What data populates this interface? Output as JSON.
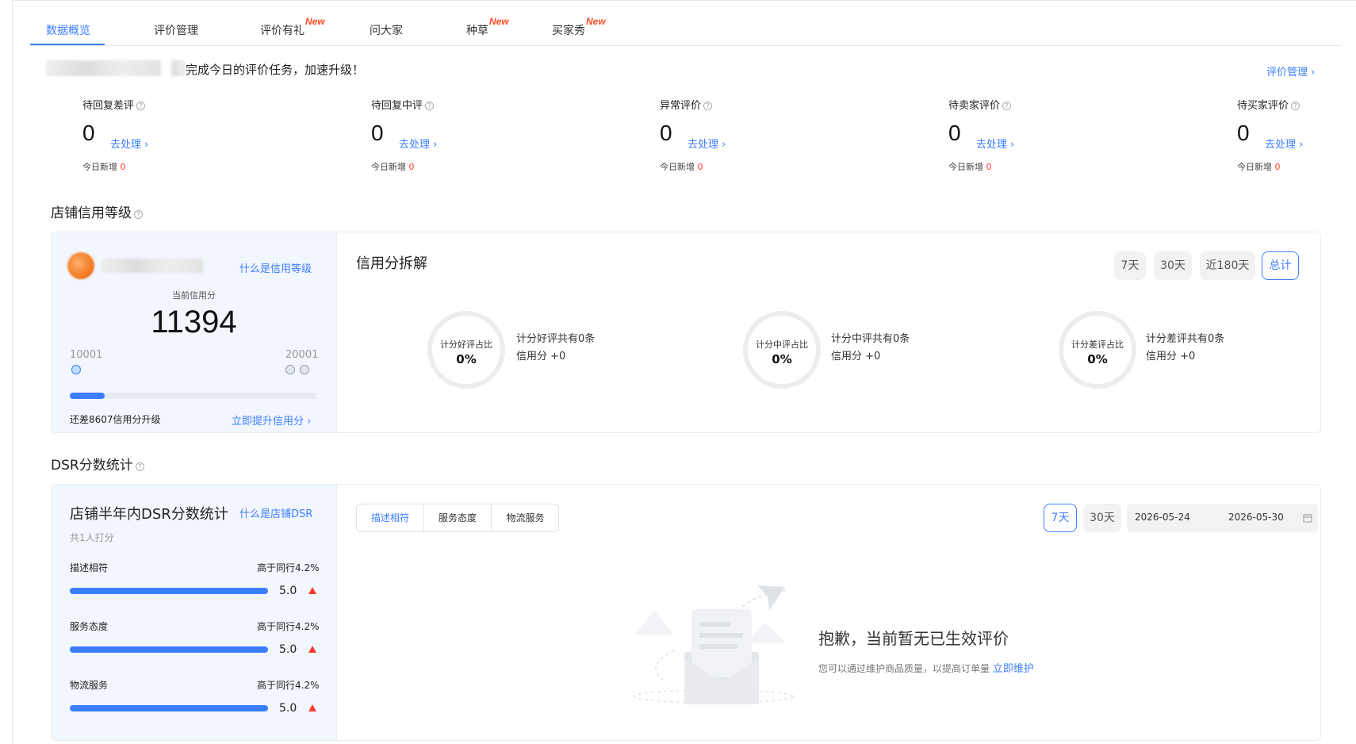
{
  "tabs": [
    {
      "label": "数据概览",
      "active": true
    },
    {
      "label": "评价管理"
    },
    {
      "label": "评价有礼",
      "badge": "New"
    },
    {
      "label": "问大家"
    },
    {
      "label": "种草",
      "badge": "New"
    },
    {
      "label": "买家秀",
      "badge": "New"
    }
  ],
  "notice": {
    "text": "完成今日的评价任务，加速升级！",
    "link": "评价管理 ›"
  },
  "stats": [
    {
      "title": "待回复差评",
      "value": "0",
      "link": "去处理 ›",
      "sub_label": "今日新增",
      "sub_value": "0"
    },
    {
      "title": "待回复中评",
      "value": "0",
      "link": "去处理 ›",
      "sub_label": "今日新增",
      "sub_value": "0"
    },
    {
      "title": "异常评价",
      "value": "0",
      "link": "去处理 ›",
      "sub_label": "今日新增",
      "sub_value": "0"
    },
    {
      "title": "待卖家评价",
      "value": "0",
      "link": "去处理 ›",
      "sub_label": "今日新增",
      "sub_value": "0"
    },
    {
      "title": "待买家评价",
      "value": "0",
      "link": "去处理 ›",
      "sub_label": "今日新增",
      "sub_value": "0"
    }
  ],
  "credit": {
    "section_title": "店铺信用等级",
    "what_link": "什么是信用等级",
    "current_label": "当前信用分",
    "score": "11394",
    "min": "10001",
    "max": "20001",
    "progress": 0.14,
    "remaining_text": "还差8607信用分升级",
    "improve_link": "立即提升信用分 ›"
  },
  "breakdown": {
    "title": "信用分拆解",
    "periods": [
      {
        "label": "7天"
      },
      {
        "label": "30天"
      },
      {
        "label": "近180天"
      },
      {
        "label": "总计",
        "active": true
      }
    ],
    "items": [
      {
        "label": "计分好评占比",
        "value": "0%",
        "line1": "计分好评共有0条",
        "line2": "信用分 +0"
      },
      {
        "label": "计分中评占比",
        "value": "0%",
        "line1": "计分中评共有0条",
        "line2": "信用分 +0"
      },
      {
        "label": "计分差评占比",
        "value": "0%",
        "line1": "计分差评共有0条",
        "line2": "信用分 +0"
      }
    ]
  },
  "dsr": {
    "section_title": "DSR分数统计",
    "card_title": "店铺半年内DSR分数统计",
    "what_link": "什么是店铺DSR",
    "count_text": "共1人打分",
    "rows": [
      {
        "label": "描述相符",
        "compare": "高于同行4.2%",
        "score": "5.0",
        "fraction": 1.0
      },
      {
        "label": "服务态度",
        "compare": "高于同行4.2%",
        "score": "5.0",
        "fraction": 1.0
      },
      {
        "label": "物流服务",
        "compare": "高于同行4.2%",
        "score": "5.0",
        "fraction": 1.0
      }
    ],
    "segments": [
      {
        "label": "描述相符",
        "active": true
      },
      {
        "label": "服务态度"
      },
      {
        "label": "物流服务"
      }
    ],
    "periods": [
      {
        "label": "7天",
        "active": true
      },
      {
        "label": "30天"
      }
    ],
    "date_start": "2026-05-24",
    "date_end": "2026-05-30",
    "empty_title": "抱歉，当前暂无已生效评价",
    "empty_sub": "您可以通过维护商品质量，以提高订单量",
    "empty_link": "立即维护"
  },
  "icons": [
    "question-icon",
    "chevron-right-icon",
    "calendar-icon",
    "arrow-up-icon",
    "empty-envelope-illustration"
  ],
  "colors": {
    "accent": "#3d7eff",
    "alert": "#ff3b30",
    "new_badge": "#ff4d2a",
    "card_bg": "#f2f6fd"
  }
}
